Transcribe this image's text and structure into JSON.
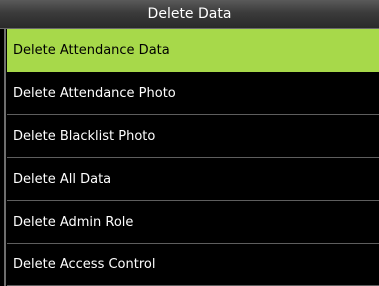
{
  "header": {
    "title": "Delete Data"
  },
  "menu": {
    "selected_index": 0,
    "items": [
      {
        "label": "Delete Attendance Data"
      },
      {
        "label": "Delete Attendance Photo"
      },
      {
        "label": "Delete Blacklist Photo"
      },
      {
        "label": "Delete All Data"
      },
      {
        "label": "Delete Admin Role"
      },
      {
        "label": "Delete Access Control"
      }
    ]
  },
  "colors": {
    "selection": "#a7d94a",
    "background": "#000000",
    "text": "#ffffff",
    "selected_text": "#000000"
  }
}
